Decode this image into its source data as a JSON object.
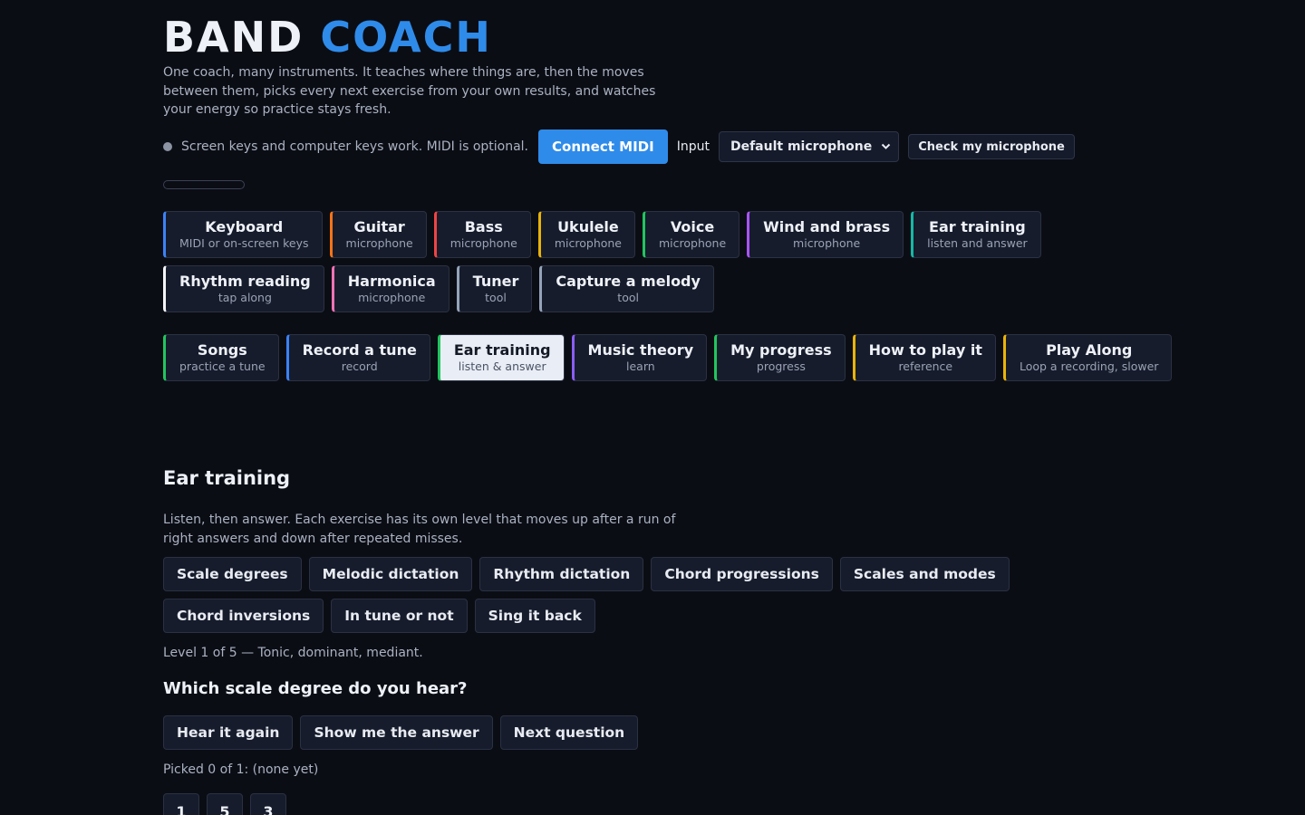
{
  "app": {
    "title_word1": "BAND",
    "title_word2": "COACH",
    "tagline": "One coach, many instruments. It teaches where things are, then the moves between them, picks every next exercise from your own results, and watches your energy so practice stays fresh."
  },
  "status": {
    "text": "Screen keys and computer keys work. MIDI is optional.",
    "connect_label": "Connect MIDI",
    "input_label": "Input",
    "input_value": "Default microphone",
    "check_mic_label": "Check my microphone",
    "level_meter": 0
  },
  "instruments": [
    {
      "title": "Keyboard",
      "sub": "MIDI or on-screen keys",
      "color": "#3b82f6"
    },
    {
      "title": "Guitar",
      "sub": "microphone",
      "color": "#f97316"
    },
    {
      "title": "Bass",
      "sub": "microphone",
      "color": "#ef4444"
    },
    {
      "title": "Ukulele",
      "sub": "microphone",
      "color": "#eab308"
    },
    {
      "title": "Voice",
      "sub": "microphone",
      "color": "#22c55e"
    },
    {
      "title": "Wind and brass",
      "sub": "microphone",
      "color": "#a855f7"
    },
    {
      "title": "Ear training",
      "sub": "listen and answer",
      "color": "#14b8a6"
    },
    {
      "title": "Rhythm reading",
      "sub": "tap along",
      "color": "#f3f4f6"
    },
    {
      "title": "Harmonica",
      "sub": "microphone",
      "color": "#f472b6"
    },
    {
      "title": "Tuner",
      "sub": "tool",
      "color": "#94a3b8"
    },
    {
      "title": "Capture a melody",
      "sub": "tool",
      "color": "#94a3b8"
    }
  ],
  "modes": [
    {
      "title": "Songs",
      "sub": "practice a tune",
      "color": "#22c55e"
    },
    {
      "title": "Record a tune",
      "sub": "record",
      "color": "#3b82f6"
    },
    {
      "title": "Ear training",
      "sub": "listen & answer",
      "color": "#22c55e",
      "active": true
    },
    {
      "title": "Music theory",
      "sub": "learn",
      "color": "#8b5cf6"
    },
    {
      "title": "My progress",
      "sub": "progress",
      "color": "#22c55e"
    },
    {
      "title": "How to play it",
      "sub": "reference",
      "color": "#eab308"
    },
    {
      "title": "Play Along",
      "sub": "Loop a recording, slower",
      "color": "#eab308"
    }
  ],
  "section": {
    "title": "Ear training",
    "description": "Listen, then answer. Each exercise has its own level that moves up after a run of right answers and down after repeated misses."
  },
  "exercises_row1": [
    "Scale degrees",
    "Melodic dictation",
    "Rhythm dictation",
    "Chord progressions",
    "Scales and modes"
  ],
  "exercises_row2": [
    "Chord inversions",
    "In tune or not",
    "Sing it back"
  ],
  "level_text": "Level 1 of 5 — Tonic, dominant, mediant.",
  "question": "Which scale degree do you hear?",
  "actions": [
    "Hear it again",
    "Show me the answer",
    "Next question"
  ],
  "picked_text": "Picked 0 of 1: (none yet)",
  "degrees": [
    "1",
    "5",
    "3"
  ]
}
